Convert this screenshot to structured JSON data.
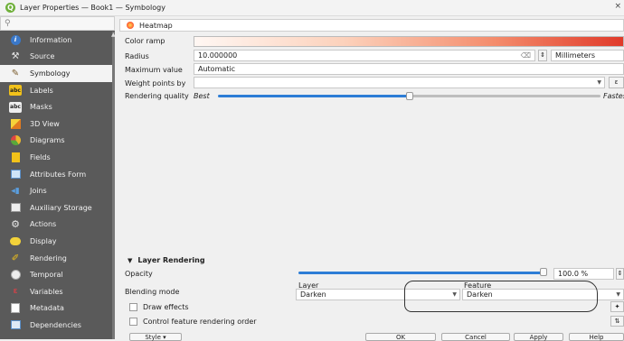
{
  "window": {
    "title": "Layer Properties — Book1 — Symbology",
    "close_glyph": "×"
  },
  "search": {
    "placeholder": ""
  },
  "sidebar": {
    "items": [
      {
        "label": "Information",
        "icon": "info-icon"
      },
      {
        "label": "Source",
        "icon": "source-icon"
      },
      {
        "label": "Symbology",
        "icon": "symbology-icon",
        "active": true
      },
      {
        "label": "Labels",
        "icon": "labels-icon"
      },
      {
        "label": "Masks",
        "icon": "masks-icon"
      },
      {
        "label": "3D View",
        "icon": "cube-icon"
      },
      {
        "label": "Diagrams",
        "icon": "diagrams-icon"
      },
      {
        "label": "Fields",
        "icon": "fields-icon"
      },
      {
        "label": "Attributes Form",
        "icon": "form-icon"
      },
      {
        "label": "Joins",
        "icon": "joins-icon"
      },
      {
        "label": "Auxiliary Storage",
        "icon": "storage-icon"
      },
      {
        "label": "Actions",
        "icon": "gear-icon"
      },
      {
        "label": "Display",
        "icon": "display-icon"
      },
      {
        "label": "Rendering",
        "icon": "brush-icon"
      },
      {
        "label": "Temporal",
        "icon": "clock-icon"
      },
      {
        "label": "Variables",
        "icon": "variables-icon"
      },
      {
        "label": "Metadata",
        "icon": "metadata-icon"
      },
      {
        "label": "Dependencies",
        "icon": "dependencies-icon"
      }
    ],
    "icon_badges": {
      "labels": "abc",
      "masks": "abc"
    }
  },
  "renderer": {
    "label": "Heatmap"
  },
  "symbology": {
    "color_ramp_label": "Color ramp",
    "radius_label": "Radius",
    "radius_value": "10.000000",
    "radius_unit": "Millimeters",
    "max_value_label": "Maximum value",
    "max_value_value": "Automatic",
    "weight_label": "Weight points by",
    "weight_value": "",
    "quality_label": "Rendering quality",
    "quality_best": "Best",
    "quality_fastest": "Fastest",
    "quality_position": 0.46
  },
  "layer_rendering": {
    "section_title": "Layer Rendering",
    "opacity_label": "Opacity",
    "opacity_value": "100.0 %",
    "opacity_fraction": 1.0,
    "blending_label": "Blending mode",
    "layer_header": "Layer",
    "layer_value": "Darken",
    "feature_header": "Feature",
    "feature_value": "Darken",
    "draw_effects_label": "Draw effects",
    "control_order_label": "Control feature rendering order"
  },
  "buttons": {
    "style": "Style",
    "ok": "OK",
    "cancel": "Cancel",
    "apply": "Apply",
    "help": "Help"
  },
  "colors": {
    "sidebar_bg": "#5a5a5a",
    "accent": "#2d7dd6",
    "ramp_start": "#fff7f3",
    "ramp_end": "#e03a2a"
  }
}
